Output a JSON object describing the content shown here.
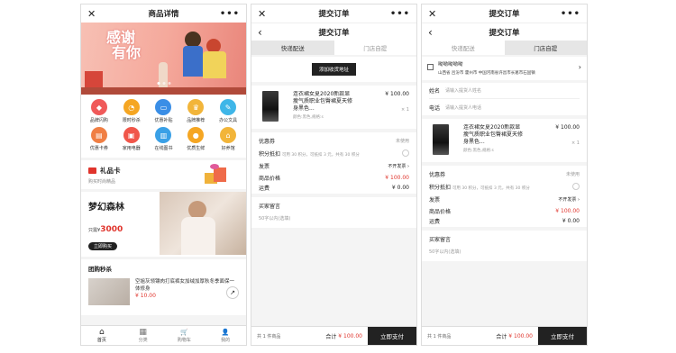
{
  "screen1": {
    "title": "商品详情",
    "close": "✕",
    "more": "•••",
    "banner_text1": "感谢",
    "banner_text2": "有你",
    "grid": [
      {
        "label": "品牌闪购",
        "color": "#f05a5a",
        "icon": "shopping-bag-icon"
      },
      {
        "label": "限时秒杀",
        "color": "#f5a623",
        "icon": "timer-icon"
      },
      {
        "label": "优惠补贴",
        "color": "#3a8ee6",
        "icon": "ticket-icon"
      },
      {
        "label": "品牌推荐",
        "color": "#f2b53a",
        "icon": "crown-icon"
      },
      {
        "label": "办公文具",
        "color": "#3fb6e8",
        "icon": "pen-icon"
      },
      {
        "label": "优惠卡券",
        "color": "#f07f44",
        "icon": "coupon-icon"
      },
      {
        "label": "家用电器",
        "color": "#f0564a",
        "icon": "appliance-icon"
      },
      {
        "label": "在线图书",
        "color": "#3aa0e6",
        "icon": "book-icon"
      },
      {
        "label": "优质生鲜",
        "color": "#f5a623",
        "icon": "fruit-icon"
      },
      {
        "label": "好养馆",
        "color": "#f2b53a",
        "icon": "shop-icon"
      }
    ],
    "gift": {
      "title": "礼品卡",
      "sub": "购买时尚精品"
    },
    "promo": {
      "title": "梦幻森林",
      "price_prefix": "只需¥",
      "price": "3000",
      "cta": "立即购买"
    },
    "flash": {
      "title": "团购秒杀",
      "item": "空姐灰领镶肉打底裤女加绒加厚秋冬季面保一体修身",
      "price": "¥ 10.00"
    },
    "nav": [
      {
        "label": "首页",
        "icon": "home-icon",
        "glyph": "⌂"
      },
      {
        "label": "分类",
        "icon": "grid-icon",
        "glyph": "▦"
      },
      {
        "label": "购物车",
        "icon": "cart-icon",
        "glyph": "🛒"
      },
      {
        "label": "我的",
        "icon": "user-icon",
        "glyph": "👤"
      }
    ]
  },
  "screen2": {
    "title": "提交订单",
    "header": "提交订单",
    "tab_delivery": "快递配送",
    "tab_pickup": "门店自提",
    "add_address": "添加收货地址",
    "product": {
      "name": "连衣裙女夏2020新款显瘦气质职业包臀裙夏天修身黑色...",
      "spec": "颜色:黑色,规格:s",
      "price": "¥ 100.00",
      "qty": "× 1"
    },
    "coupon_label": "优惠券",
    "coupon_value": "未使用",
    "points_label": "积分抵扣",
    "points_desc": "可用 30 积分，可抵扣 3 元，共有 30 积分",
    "invoice_label": "发票",
    "invoice_value": "不开发票",
    "subtotal_label": "商品价格",
    "subtotal": "¥ 100.00",
    "shipping_label": "运费",
    "shipping": "¥ 0.00",
    "memo_label": "买家留言",
    "memo_placeholder": "50字以内(选填)",
    "footer_count": "共 1 件商品",
    "footer_total_label": "合计",
    "footer_total": "¥ 100.00",
    "pay": "立即支付"
  },
  "screen3": {
    "title": "提交订单",
    "header": "提交订单",
    "tab_delivery": "快递配送",
    "tab_pickup": "门店自提",
    "store_name": "呦呦呦呦呦",
    "store_addr": "山西省 吕汾市 霍州市 中国河南省许昌市长葛市石固镇",
    "name_label": "姓名",
    "name_placeholder": "请输入提货人姓名",
    "phone_label": "电话",
    "phone_placeholder": "请输入提货人电话",
    "product": {
      "name": "连衣裙女夏2020新款显瘦气质职业包臀裙夏天修身黑色...",
      "spec": "颜色:黑色,规格:s",
      "price": "¥ 100.00",
      "qty": "× 1"
    },
    "coupon_label": "优惠券",
    "coupon_value": "未使用",
    "points_label": "积分抵扣",
    "points_desc": "可用 30 积分，可抵扣 3 元，共有 30 积分",
    "invoice_label": "发票",
    "invoice_value": "不开发票",
    "subtotal_label": "商品价格",
    "subtotal": "¥ 100.00",
    "shipping_label": "运费",
    "shipping": "¥ 0.00",
    "memo_label": "买家留言",
    "memo_placeholder": "50字以内(选填)",
    "footer_count": "共 1 件商品",
    "footer_total_label": "合计",
    "footer_total": "¥ 100.00",
    "pay": "立即支付"
  }
}
